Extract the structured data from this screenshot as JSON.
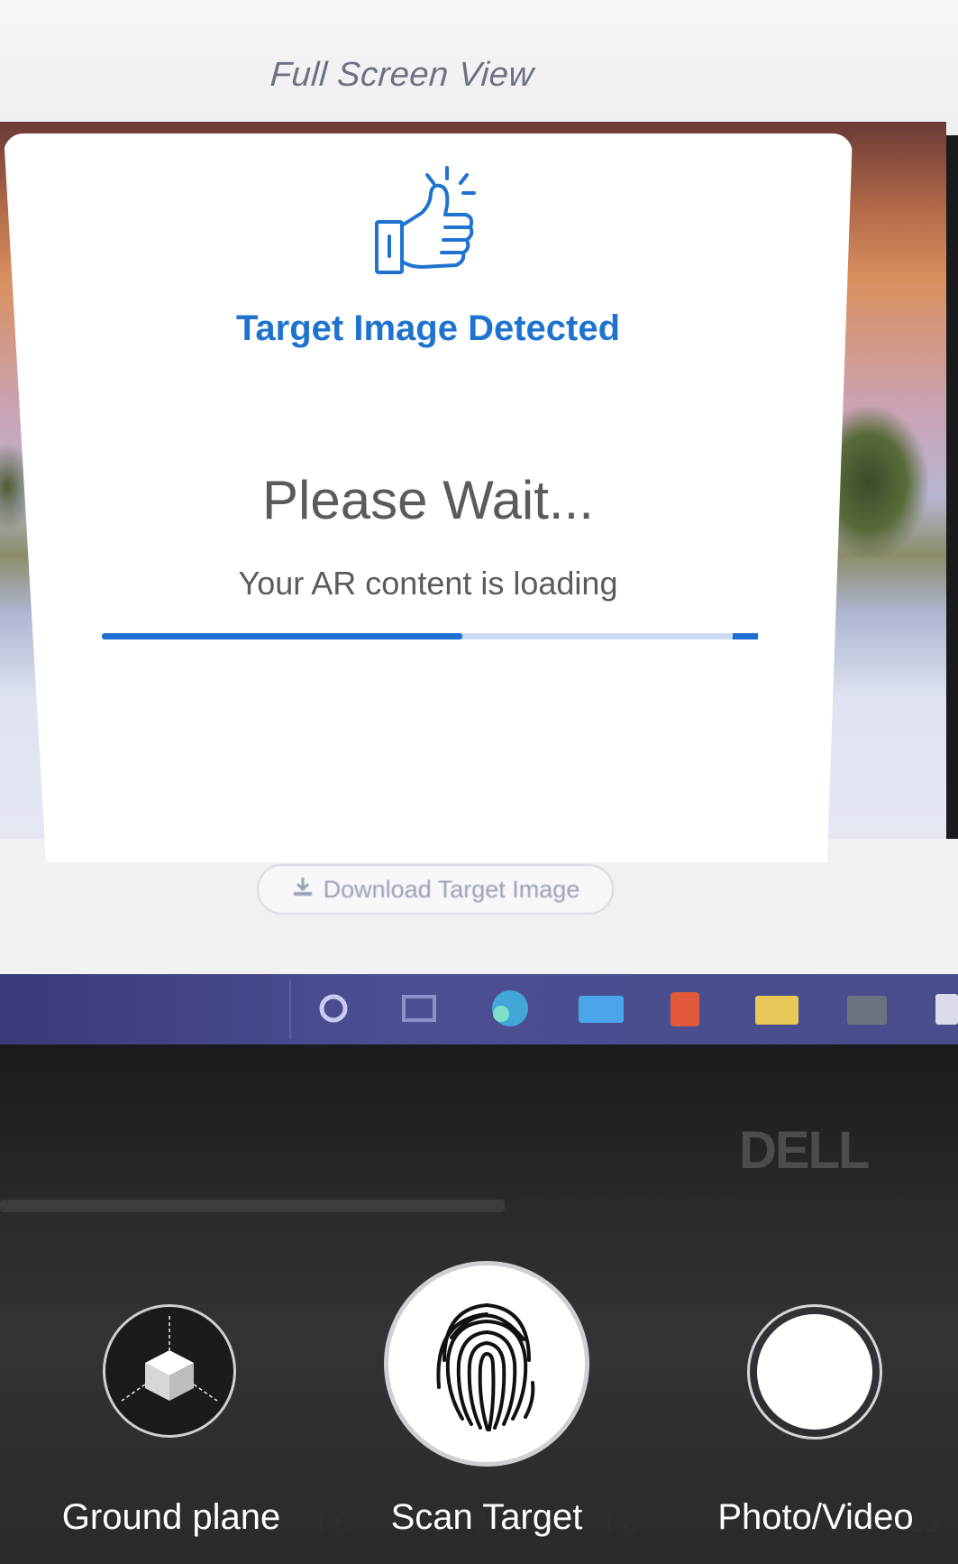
{
  "background": {
    "screen_title": "Full Screen View",
    "download_button_label": "Download Target Image",
    "laptop_brand": "DELL",
    "function_keys": [
      "F6",
      "F7",
      "F8",
      "F9",
      "F10"
    ]
  },
  "dialog": {
    "heading": "Target Image Detected",
    "title": "Please Wait...",
    "subtitle": "Your AR content is loading",
    "progress": 0.55,
    "accent_color": "#1f73cf"
  },
  "controls": {
    "ground_plane_label": "Ground plane",
    "scan_target_label": "Scan Target",
    "photo_video_label": "Photo/Video"
  },
  "icons": [
    "thumbs-up-icon",
    "cube-icon",
    "fingerprint-icon",
    "download-icon"
  ]
}
